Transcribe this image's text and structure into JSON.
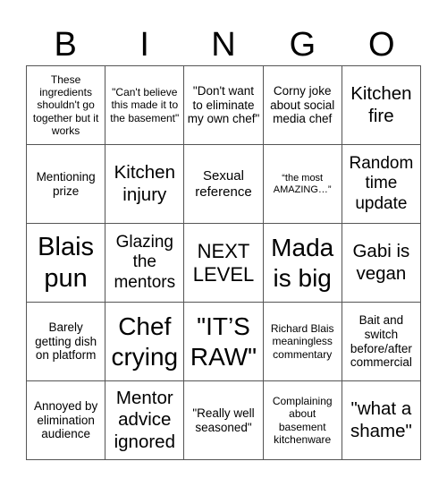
{
  "header": [
    "B",
    "I",
    "N",
    "G",
    "O"
  ],
  "cells": [
    "These ingredients shouldn't go together but it works",
    "\"Can't believe this made it to the basement\"",
    "\"Don't want to eliminate my own chef\"",
    "Corny joke about social media chef",
    "Kitchen fire",
    "Mentioning prize",
    "Kitchen injury",
    "Sexual reference",
    "“the most AMAZING…”",
    "Random time update",
    "Blais pun",
    "Glazing the mentors",
    "NEXT LEVEL",
    "Mada is big",
    "Gabi is vegan",
    "Barely getting dish on platform",
    "Chef crying",
    "\"IT’S RAW\"",
    "Richard Blais meaningless commentary",
    "Bait and switch before/after commercial",
    "Annoyed by elimination audience",
    "Mentor advice ignored",
    "\"Really well seasoned\"",
    "Complaining about basement kitchenware",
    "\"what a shame\""
  ]
}
